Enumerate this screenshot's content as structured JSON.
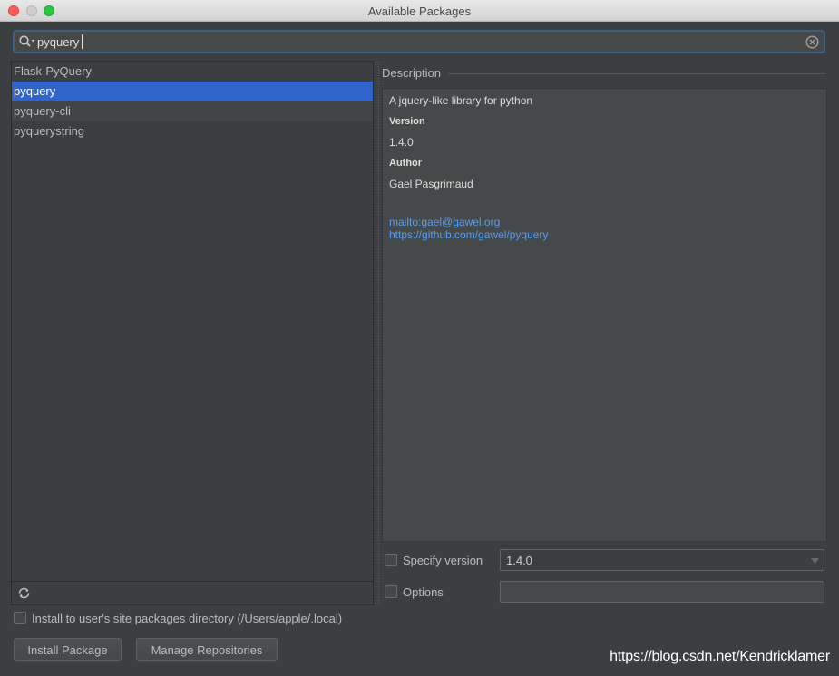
{
  "window": {
    "title": "Available Packages"
  },
  "search": {
    "value": "pyquery",
    "placeholder": ""
  },
  "packages": {
    "items": [
      {
        "label": "Flask-PyQuery"
      },
      {
        "label": "pyquery"
      },
      {
        "label": "pyquery-cli"
      },
      {
        "label": "pyquerystring"
      }
    ]
  },
  "description": {
    "header": "Description",
    "summary": "A jquery-like library for python",
    "version_label": "Version",
    "version": "1.4.0",
    "author_label": "Author",
    "author": "Gael Pasgrimaud",
    "email_link": "mailto:gael@gawel.org",
    "homepage_link": "https://github.com/gawel/pyquery"
  },
  "options": {
    "specify_version_label": "Specify version",
    "specify_version_checked": false,
    "version_value": "1.4.0",
    "options_label": "Options",
    "options_checked": false,
    "options_value": "",
    "user_site_label": "Install to user's site packages directory (/Users/apple/.local)",
    "user_site_checked": false
  },
  "buttons": {
    "install": "Install Package",
    "manage": "Manage Repositories"
  },
  "watermark": "https://blog.csdn.net/Kendricklamer",
  "colors": {
    "background": "#3c3f41",
    "selection": "#2f65ca",
    "link": "#589df6",
    "focus_border": "#3d6185"
  },
  "icons": {
    "search": "search-icon",
    "clear": "clear-icon",
    "refresh": "refresh-icon",
    "dropdown": "chevron-down-icon"
  }
}
